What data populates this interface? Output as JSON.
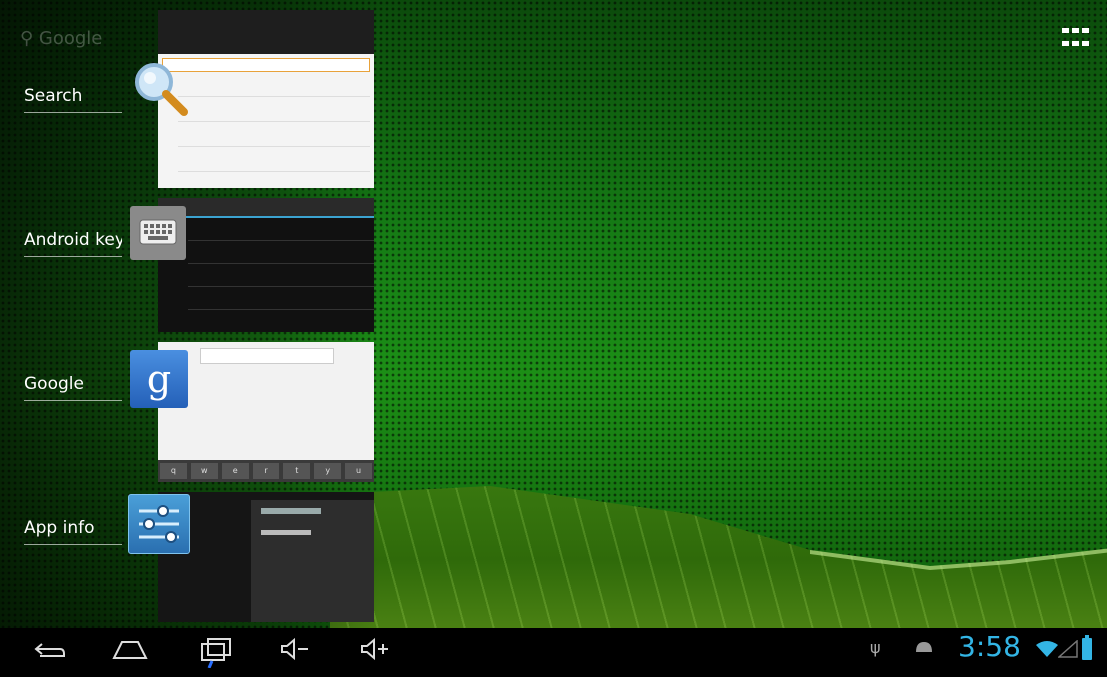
{
  "home": {
    "search_hint": "Google"
  },
  "recent_apps": [
    {
      "label": "Search",
      "icon": "magnifier-icon"
    },
    {
      "label": "Android keyboard",
      "icon": "keyboard-icon"
    },
    {
      "label": "Google",
      "icon": "google-g-icon"
    },
    {
      "label": "App info",
      "icon": "settings-sliders-icon"
    }
  ],
  "navbar": {
    "back": "back-icon",
    "home": "home-icon",
    "recents": "recents-icon",
    "vol_down": "volume-down-icon",
    "vol_up": "volume-up-icon",
    "time": "3:58"
  },
  "colors": {
    "accent": "#33b5e5",
    "wallpaper": "#1c8f16"
  }
}
